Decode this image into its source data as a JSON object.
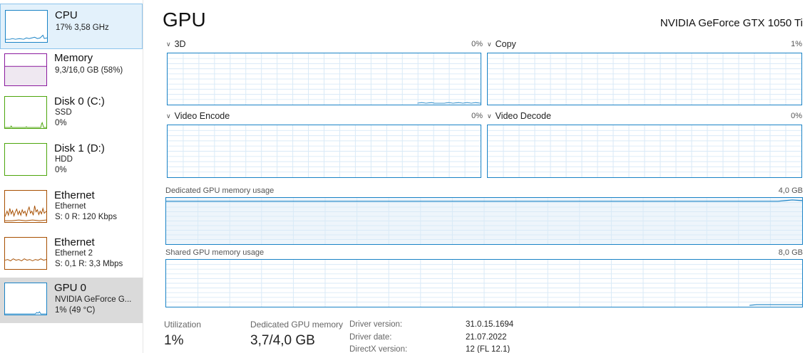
{
  "sidebar": {
    "items": [
      {
        "title": "CPU",
        "line1": "17% 3,58 GHz",
        "line2": "",
        "color": "#1a83c6"
      },
      {
        "title": "Memory",
        "line1": "9,3/16,0 GB (58%)",
        "line2": "",
        "color": "#8b1b9e"
      },
      {
        "title": "Disk 0 (C:)",
        "line1": "SSD",
        "line2": "0%",
        "color": "#4da60c"
      },
      {
        "title": "Disk 1 (D:)",
        "line1": "HDD",
        "line2": "0%",
        "color": "#4da60c"
      },
      {
        "title": "Ethernet",
        "line1": "Ethernet",
        "line2": "S: 0 R: 120 Kbps",
        "color": "#a74f01"
      },
      {
        "title": "Ethernet",
        "line1": "Ethernet 2",
        "line2": "S: 0,1 R: 3,3 Mbps",
        "color": "#a74f01"
      },
      {
        "title": "GPU 0",
        "line1": "NVIDIA GeForce G...",
        "line2": "1% (49 °C)",
        "color": "#1a83c6"
      }
    ]
  },
  "main": {
    "title": "GPU",
    "model": "NVIDIA GeForce GTX 1050 Ti",
    "engines": [
      {
        "label": "3D",
        "percent": "0%"
      },
      {
        "label": "Copy",
        "percent": "1%"
      },
      {
        "label": "Video Encode",
        "percent": "0%"
      },
      {
        "label": "Video Decode",
        "percent": "0%"
      }
    ],
    "dedicated": {
      "label": "Dedicated GPU memory usage",
      "max": "4,0 GB"
    },
    "shared": {
      "label": "Shared GPU memory usage",
      "max": "8,0 GB"
    },
    "stats": {
      "utilization_label": "Utilization",
      "utilization_value": "1%",
      "dedicated_label": "Dedicated GPU memory",
      "dedicated_value": "3,7/4,0 GB"
    },
    "info": {
      "driver_version_label": "Driver version:",
      "driver_version": "31.0.15.1694",
      "driver_date_label": "Driver date:",
      "driver_date": "21.07.2022",
      "directx_label": "DirectX version:",
      "directx": "12 (FL 12.1)"
    }
  },
  "colors": {
    "accent_blue": "#1a83c6",
    "memory_purple": "#8b1b9e",
    "disk_green": "#4da60c",
    "ethernet_brown": "#a74f01",
    "graph_grid": "#d9eaf7",
    "memory_fill": "#eef5fb"
  }
}
